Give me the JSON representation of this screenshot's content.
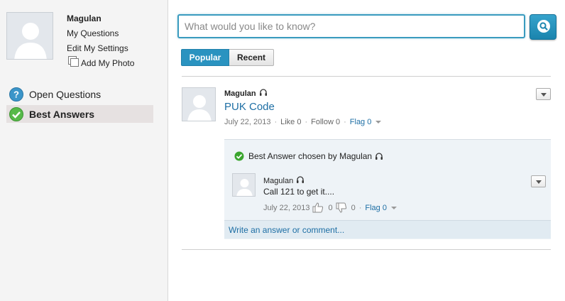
{
  "profile": {
    "name": "Magulan",
    "links": [
      "My Questions",
      "Edit My Settings",
      "Add My Photo"
    ]
  },
  "nav": {
    "open_questions": "Open Questions",
    "best_answers": "Best Answers"
  },
  "search": {
    "placeholder": "What would you like to know?",
    "value": ""
  },
  "tabs": {
    "popular": "Popular",
    "recent": "Recent",
    "active": "Popular"
  },
  "question": {
    "author": "Magulan",
    "title": "PUK Code",
    "date": "July 22, 2013",
    "like": "Like 0",
    "follow": "Follow 0",
    "flag": "Flag 0"
  },
  "answer": {
    "best_label": "Best Answer chosen by Magulan",
    "author": "Magulan",
    "text": "Call 121 to get it....",
    "date": "July 22, 2013",
    "up_count": "0",
    "down_count": "0",
    "flag": "Flag 0",
    "write_prompt": "Write an answer or comment..."
  },
  "colors": {
    "accent": "#2a93c0",
    "link": "#1d6ea4",
    "best_check": "#3aa52e"
  }
}
